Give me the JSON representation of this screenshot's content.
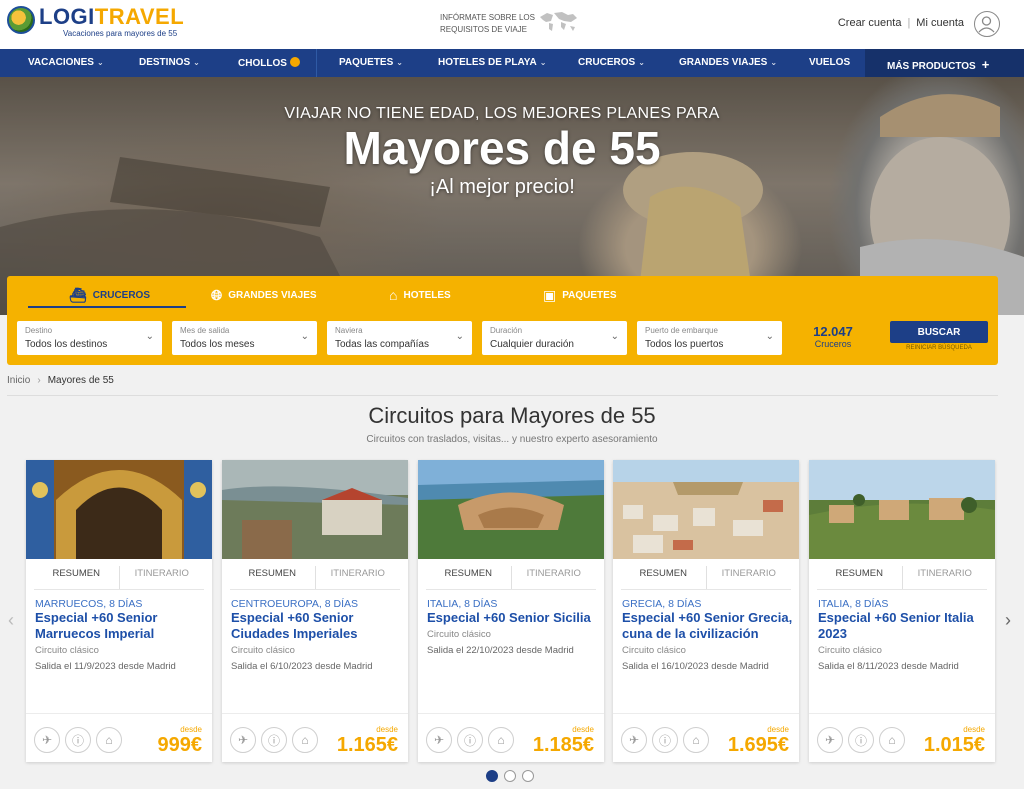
{
  "header": {
    "logo_word_a": "LOGI",
    "logo_word_b": "TRAVEL",
    "logo_tagline": "Vacaciones para mayores de 55",
    "visa_line1": "Infórmate sobre los",
    "visa_line2": "requisitos de viaje",
    "create_account": "Crear cuenta",
    "my_account": "Mi cuenta"
  },
  "nav": {
    "items": [
      "VACACIONES",
      "DESTINOS",
      "CHOLLOS",
      "PAQUETES",
      "HOTELES DE PLAYA",
      "CRUCEROS",
      "GRANDES VIAJES",
      "VUELOS",
      "MÁS PRODUCTOS"
    ],
    "more_icon": "+"
  },
  "hero": {
    "kicker": "VIAJAR NO TIENE EDAD, LOS MEJORES PLANES PARA",
    "title": "Mayores de 55",
    "subtitle": "¡Al mejor precio!"
  },
  "search": {
    "tabs": [
      "CRUCEROS",
      "GRANDES VIAJES",
      "HOTELES",
      "PAQUETES"
    ],
    "fields": [
      {
        "label": "Destino",
        "value": "Todos los destinos"
      },
      {
        "label": "Mes de salida",
        "value": "Todos los meses"
      },
      {
        "label": "Naviera",
        "value": "Todas las compañías"
      },
      {
        "label": "Duración",
        "value": "Cualquier duración"
      },
      {
        "label": "Puerto de embarque",
        "value": "Todos los puertos"
      }
    ],
    "count": "12.047",
    "count_unit": "Cruceros",
    "button": "BUSCAR",
    "reset": "REINICIAR BÚSQUEDA"
  },
  "breadcrumb": {
    "home": "Inicio",
    "current": "Mayores de 55"
  },
  "section": {
    "title": "Circuitos para Mayores de 55",
    "subtitle": "Circuitos con traslados, visitas... y nuestro experto asesoramiento"
  },
  "cards": [
    {
      "tab1": "RESUMEN",
      "tab2": "ITINERARIO",
      "dest": "MARRUECOS, 8 DÍAS",
      "name": "Especial +60 Senior Marruecos Imperial",
      "type": "Circuito clásico",
      "date": "Salida el 11/9/2023 desde Madrid",
      "from": "desde",
      "price": "999€"
    },
    {
      "tab1": "RESUMEN",
      "tab2": "ITINERARIO",
      "dest": "CENTROEUROPA, 8 DÍAS",
      "name": "Especial +60 Senior Ciudades Imperiales",
      "type": "Circuito clásico",
      "date": "Salida el 6/10/2023 desde Madrid",
      "from": "desde",
      "price": "1.165€"
    },
    {
      "tab1": "RESUMEN",
      "tab2": "ITINERARIO",
      "dest": "ITALIA, 8 DÍAS",
      "name": "Especial +60 Senior Sicilia",
      "type": "Circuito clásico",
      "date": "Salida el 22/10/2023 desde Madrid",
      "from": "desde",
      "price": "1.185€"
    },
    {
      "tab1": "RESUMEN",
      "tab2": "ITINERARIO",
      "dest": "GRECIA, 8 DÍAS",
      "name": "Especial +60 Senior Grecia, cuna de la civilización",
      "type": "Circuito clásico",
      "date": "Salida el 16/10/2023 desde Madrid",
      "from": "desde",
      "price": "1.695€"
    },
    {
      "tab1": "RESUMEN",
      "tab2": "ITINERARIO",
      "dest": "ITALIA, 8 DÍAS",
      "name": "Especial +60 Senior Italia 2023",
      "type": "Circuito clásico",
      "date": "Salida el 8/11/2023 desde Madrid",
      "from": "desde",
      "price": "1.015€"
    }
  ],
  "colors": {
    "brand_blue": "#1d3f87",
    "accent_yellow": "#f5b200",
    "link_blue": "#1d4fa8"
  }
}
